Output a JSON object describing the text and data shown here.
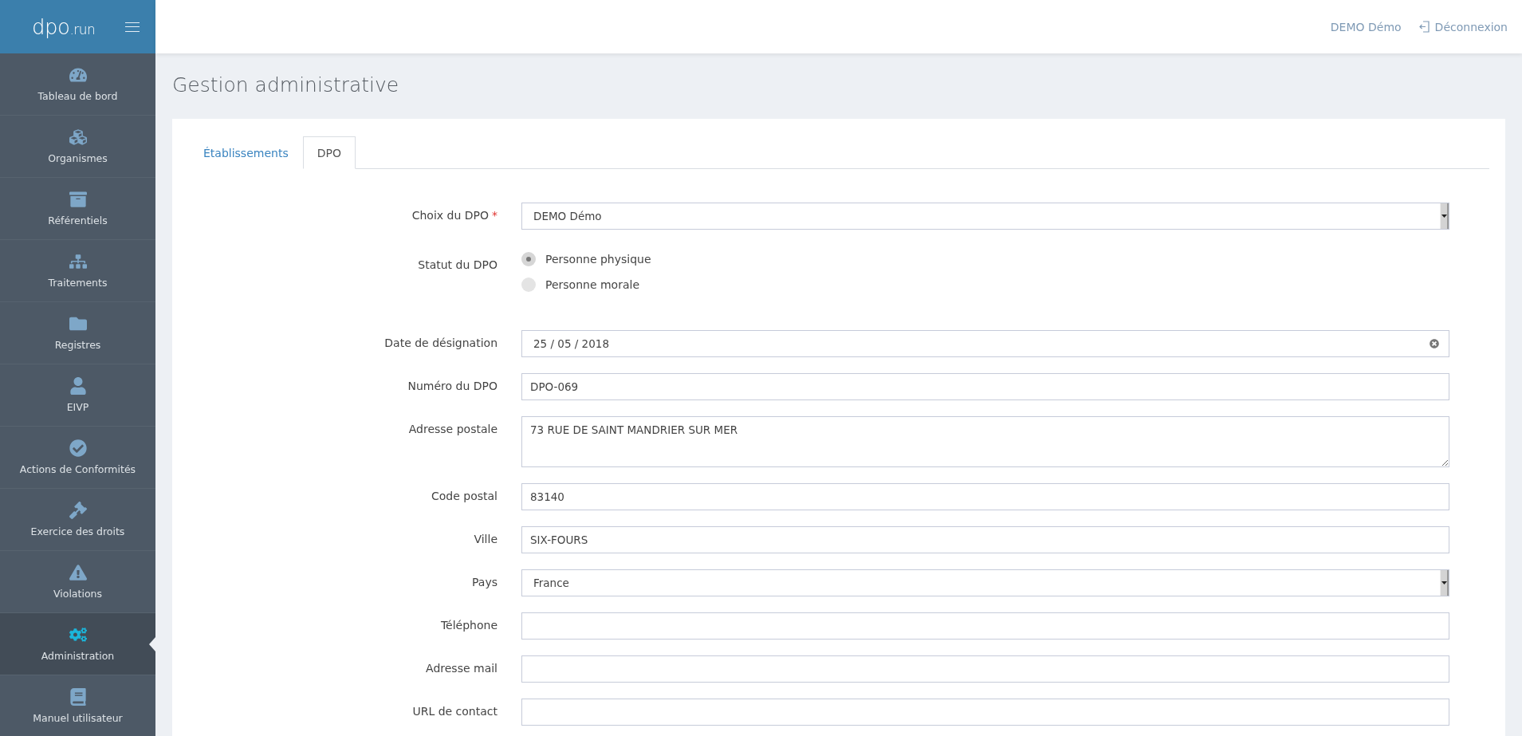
{
  "brand": {
    "logo_main": "dpo",
    "logo_suffix": ".run"
  },
  "sidebar": {
    "items": [
      {
        "label": "Tableau de bord",
        "selected": false
      },
      {
        "label": "Organismes",
        "selected": false
      },
      {
        "label": "Référentiels",
        "selected": false
      },
      {
        "label": "Traitements",
        "selected": false
      },
      {
        "label": "Registres",
        "selected": false
      },
      {
        "label": "EIVP",
        "selected": false
      },
      {
        "label": "Actions de Conformités",
        "selected": false
      },
      {
        "label": "Exercice des droits",
        "selected": false
      },
      {
        "label": "Violations",
        "selected": false
      },
      {
        "label": "Administration",
        "selected": true
      },
      {
        "label": "Manuel utilisateur",
        "selected": false
      }
    ]
  },
  "topbar": {
    "user": "DEMO Démo",
    "logout": "Déconnexion"
  },
  "page": {
    "title": "Gestion administrative"
  },
  "tabs": [
    {
      "label": "Établissements",
      "selected": false
    },
    {
      "label": "DPO",
      "selected": true
    }
  ],
  "form": {
    "fields": [
      {
        "kind": "select",
        "label": "Choix du DPO",
        "required_mark": "*",
        "value": "DEMO Démo"
      },
      {
        "kind": "radio",
        "label": "Statut du DPO",
        "options": [
          {
            "label": "Personne physique",
            "selected": true
          },
          {
            "label": "Personne morale",
            "selected": false
          }
        ]
      },
      {
        "kind": "date",
        "label": "Date de désignation",
        "value": "25 / 05 / 2018"
      },
      {
        "kind": "text",
        "label": "Numéro du DPO",
        "value": "DPO-069"
      },
      {
        "kind": "textarea",
        "label": "Adresse postale",
        "value": "73 RUE DE SAINT MANDRIER SUR MER"
      },
      {
        "kind": "text",
        "label": "Code postal",
        "value": "83140"
      },
      {
        "kind": "text",
        "label": "Ville",
        "value": "SIX-FOURS"
      },
      {
        "kind": "select",
        "label": "Pays",
        "value": "France"
      },
      {
        "kind": "text",
        "label": "Téléphone"
      },
      {
        "kind": "text",
        "label": "Adresse mail"
      },
      {
        "kind": "text",
        "label": "URL de contact"
      }
    ]
  }
}
